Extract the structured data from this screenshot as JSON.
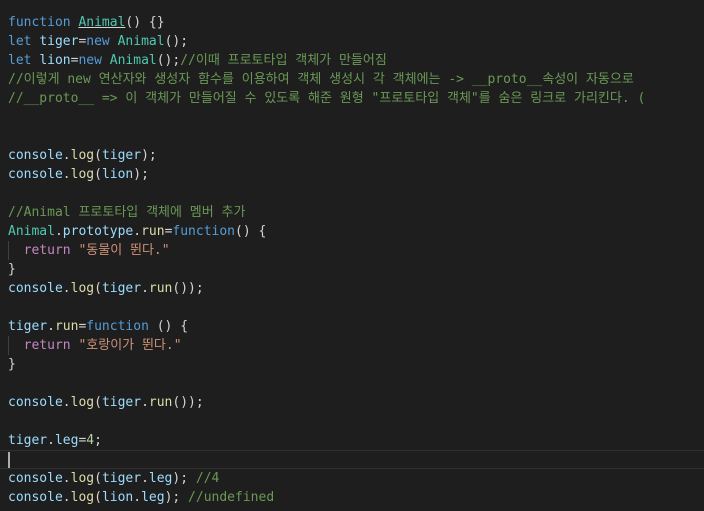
{
  "editor": {
    "lines": [
      [
        {
          "t": "function",
          "c": "kw"
        },
        {
          "t": " ",
          "c": "pl"
        },
        {
          "t": "Animal",
          "c": "cls ul"
        },
        {
          "t": "() {}",
          "c": "pl"
        }
      ],
      [
        {
          "t": "let",
          "c": "kw"
        },
        {
          "t": " ",
          "c": "pl"
        },
        {
          "t": "tiger",
          "c": "var"
        },
        {
          "t": "=",
          "c": "pl"
        },
        {
          "t": "new",
          "c": "kw"
        },
        {
          "t": " ",
          "c": "pl"
        },
        {
          "t": "Animal",
          "c": "cls"
        },
        {
          "t": "();",
          "c": "pl"
        }
      ],
      [
        {
          "t": "let",
          "c": "kw"
        },
        {
          "t": " ",
          "c": "pl"
        },
        {
          "t": "lion",
          "c": "var"
        },
        {
          "t": "=",
          "c": "pl"
        },
        {
          "t": "new",
          "c": "kw"
        },
        {
          "t": " ",
          "c": "pl"
        },
        {
          "t": "Animal",
          "c": "cls"
        },
        {
          "t": "();",
          "c": "pl"
        },
        {
          "t": "//이때 프로토타입 객체가 만들어짐",
          "c": "cmt"
        }
      ],
      [
        {
          "t": "//이렇게 new 연산자와 생성자 함수를 이용하여 객체 생성시 각 객체에는 -> __proto__속성이 자동으로",
          "c": "cmt"
        }
      ],
      [
        {
          "t": "//__proto__ => 이 객체가 만들어질 수 있도록 해준 원형 \"프로토타입 객체\"를 숨은 링크로 가리킨다. (",
          "c": "cmt"
        }
      ],
      [],
      [],
      [
        {
          "t": "console",
          "c": "var"
        },
        {
          "t": ".",
          "c": "pl"
        },
        {
          "t": "log",
          "c": "fn"
        },
        {
          "t": "(",
          "c": "pl"
        },
        {
          "t": "tiger",
          "c": "var"
        },
        {
          "t": ");",
          "c": "pl"
        }
      ],
      [
        {
          "t": "console",
          "c": "var"
        },
        {
          "t": ".",
          "c": "pl"
        },
        {
          "t": "log",
          "c": "fn"
        },
        {
          "t": "(",
          "c": "pl"
        },
        {
          "t": "lion",
          "c": "var"
        },
        {
          "t": ");",
          "c": "pl"
        }
      ],
      [],
      [
        {
          "t": "//Animal 프로토타입 객체에 멤버 추가",
          "c": "cmt"
        }
      ],
      [
        {
          "t": "Animal",
          "c": "cls"
        },
        {
          "t": ".",
          "c": "pl"
        },
        {
          "t": "prototype",
          "c": "var"
        },
        {
          "t": ".",
          "c": "pl"
        },
        {
          "t": "run",
          "c": "fn"
        },
        {
          "t": "=",
          "c": "pl"
        },
        {
          "t": "function",
          "c": "kw"
        },
        {
          "t": "() {",
          "c": "pl"
        }
      ],
      [
        {
          "t": "GUIDE",
          "c": "guide"
        },
        {
          "t": "  ",
          "c": "pl"
        },
        {
          "t": "return",
          "c": "ctl"
        },
        {
          "t": " ",
          "c": "pl"
        },
        {
          "t": "\"동물이 뛴다.\"",
          "c": "str"
        }
      ],
      [
        {
          "t": "}",
          "c": "pl"
        }
      ],
      [
        {
          "t": "console",
          "c": "var"
        },
        {
          "t": ".",
          "c": "pl"
        },
        {
          "t": "log",
          "c": "fn"
        },
        {
          "t": "(",
          "c": "pl"
        },
        {
          "t": "tiger",
          "c": "var"
        },
        {
          "t": ".",
          "c": "pl"
        },
        {
          "t": "run",
          "c": "fn"
        },
        {
          "t": "());",
          "c": "pl"
        }
      ],
      [],
      [
        {
          "t": "tiger",
          "c": "var"
        },
        {
          "t": ".",
          "c": "pl"
        },
        {
          "t": "run",
          "c": "fn"
        },
        {
          "t": "=",
          "c": "pl"
        },
        {
          "t": "function",
          "c": "kw"
        },
        {
          "t": " () {",
          "c": "pl"
        }
      ],
      [
        {
          "t": "GUIDE",
          "c": "guide"
        },
        {
          "t": "  ",
          "c": "pl"
        },
        {
          "t": "return",
          "c": "ctl"
        },
        {
          "t": " ",
          "c": "pl"
        },
        {
          "t": "\"호랑이가 뛴다.\"",
          "c": "str"
        }
      ],
      [
        {
          "t": "}",
          "c": "pl"
        }
      ],
      [],
      [
        {
          "t": "console",
          "c": "var"
        },
        {
          "t": ".",
          "c": "pl"
        },
        {
          "t": "log",
          "c": "fn"
        },
        {
          "t": "(",
          "c": "pl"
        },
        {
          "t": "tiger",
          "c": "var"
        },
        {
          "t": ".",
          "c": "pl"
        },
        {
          "t": "run",
          "c": "fn"
        },
        {
          "t": "());",
          "c": "pl"
        }
      ],
      [],
      [
        {
          "t": "tiger",
          "c": "var"
        },
        {
          "t": ".",
          "c": "pl"
        },
        {
          "t": "leg",
          "c": "var"
        },
        {
          "t": "=",
          "c": "pl"
        },
        {
          "t": "4",
          "c": "num"
        },
        {
          "t": ";",
          "c": "pl"
        }
      ],
      [],
      [
        {
          "t": "console",
          "c": "var"
        },
        {
          "t": ".",
          "c": "pl"
        },
        {
          "t": "log",
          "c": "fn"
        },
        {
          "t": "(",
          "c": "pl"
        },
        {
          "t": "tiger",
          "c": "var"
        },
        {
          "t": ".",
          "c": "pl"
        },
        {
          "t": "leg",
          "c": "var"
        },
        {
          "t": "); ",
          "c": "pl"
        },
        {
          "t": "//4",
          "c": "cmt"
        }
      ],
      [
        {
          "t": "console",
          "c": "var"
        },
        {
          "t": ".",
          "c": "pl"
        },
        {
          "t": "log",
          "c": "fn"
        },
        {
          "t": "(",
          "c": "pl"
        },
        {
          "t": "lion",
          "c": "var"
        },
        {
          "t": ".",
          "c": "pl"
        },
        {
          "t": "leg",
          "c": "var"
        },
        {
          "t": "); ",
          "c": "pl"
        },
        {
          "t": "//undefined",
          "c": "cmt"
        }
      ]
    ],
    "active_line": 23
  }
}
